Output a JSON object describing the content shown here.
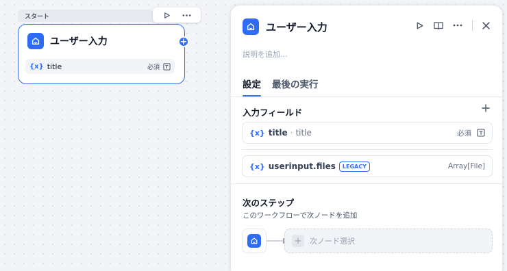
{
  "canvas": {
    "node_tag": "スタート",
    "node_title": "ユーザー入力",
    "variable": {
      "symbol": "{x}",
      "name": "title",
      "required": "必須"
    }
  },
  "panel": {
    "title": "ユーザー入力",
    "description_placeholder": "説明を追加...",
    "tabs": [
      {
        "label": "設定",
        "active": true
      },
      {
        "label": "最後の実行",
        "active": false
      }
    ],
    "input_fields": {
      "title": "入力フィールド",
      "items": [
        {
          "symbol": "{x}",
          "name": "title",
          "separator": "·",
          "label": "title",
          "required": "必須"
        },
        {
          "symbol": "{x}",
          "name": "userinput.files",
          "badge": "LEGACY",
          "type": "Array[File]"
        }
      ]
    },
    "next_step": {
      "title": "次のステップ",
      "description": "このワークフローで次ノードを追加",
      "select_label": "次ノード選択"
    }
  },
  "colors": {
    "accent": "#2e6cf6",
    "canvas_bg": "#f2f4f7"
  }
}
